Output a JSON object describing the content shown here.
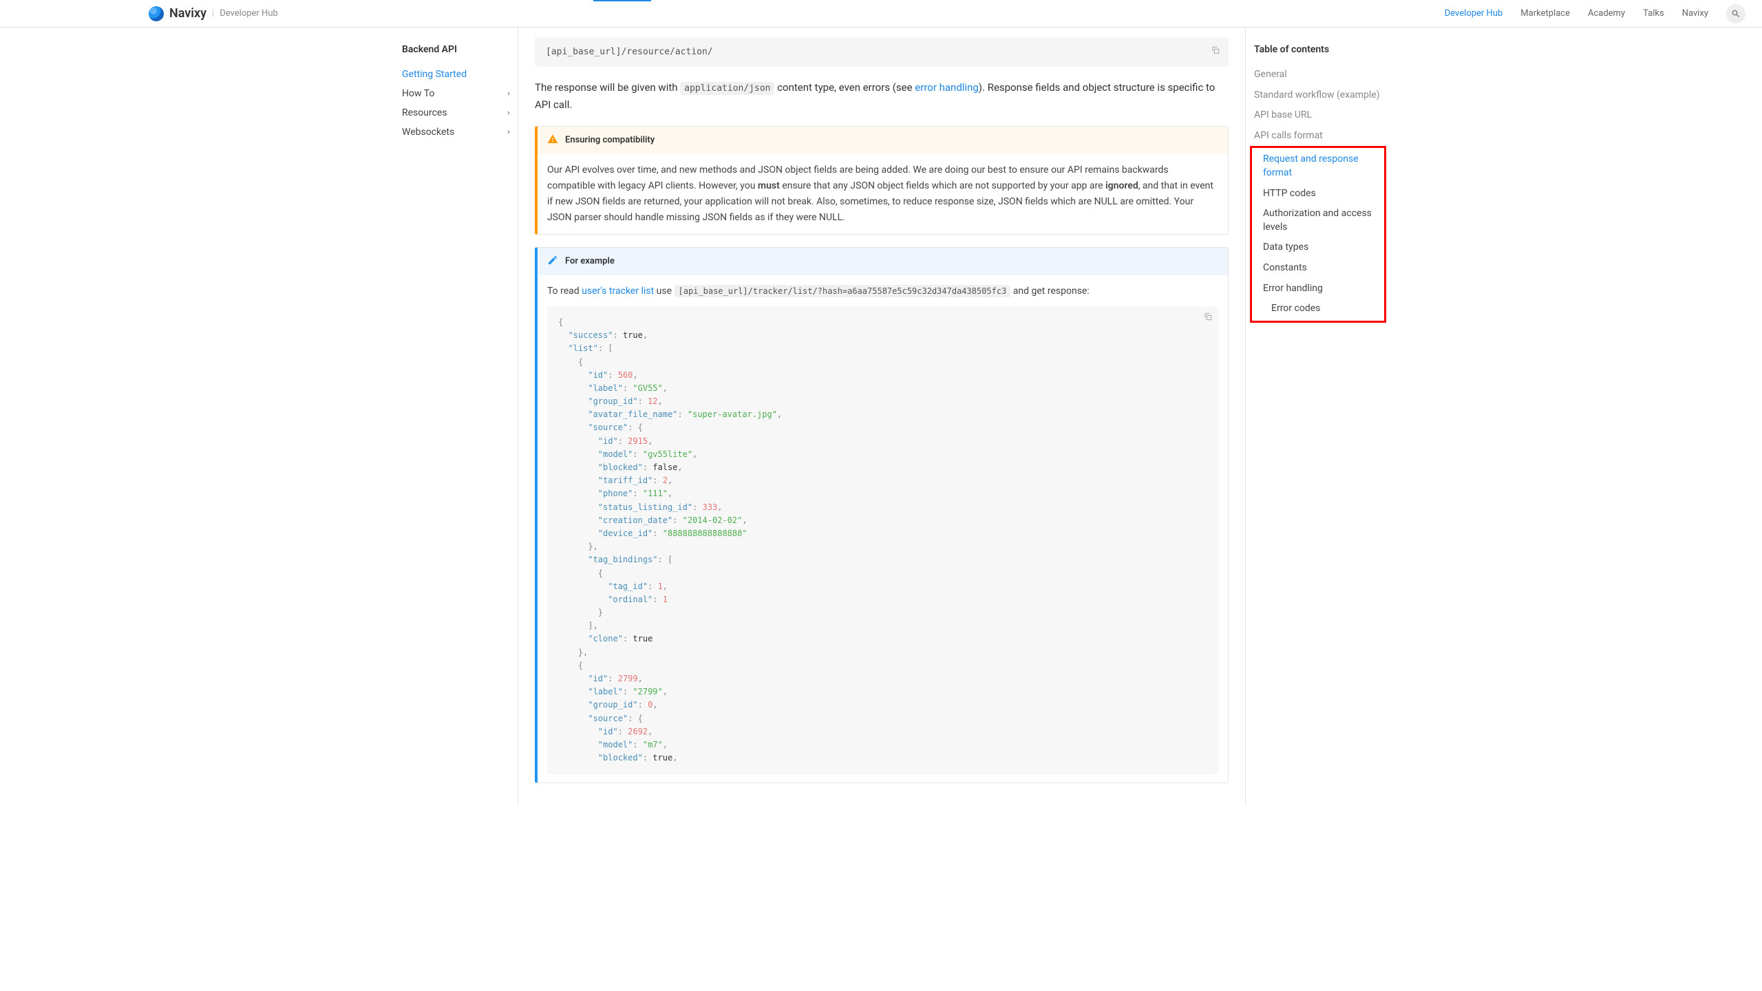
{
  "header": {
    "brand": "Navixy",
    "sub": "Developer Hub",
    "nav": [
      "Developer Hub",
      "Marketplace",
      "Academy",
      "Talks",
      "Navixy"
    ],
    "active_nav_index": 0
  },
  "sidebar": {
    "title": "Backend API",
    "items": [
      {
        "label": "Getting Started",
        "active": true,
        "expandable": false
      },
      {
        "label": "How To",
        "active": false,
        "expandable": true
      },
      {
        "label": "Resources",
        "active": false,
        "expandable": true
      },
      {
        "label": "Websockets",
        "active": false,
        "expandable": true
      }
    ]
  },
  "main": {
    "url_template": "[api_base_url]/resource/action/",
    "para1_pre": "The response will be given with ",
    "para1_code": "application/json",
    "para1_mid": " content type, even errors (see ",
    "para1_link": "error handling",
    "para1_post": "). Response fields and object structure is specific to API call.",
    "warn_title": "Ensuring compatibility",
    "warn_body_1": "Our API evolves over time, and new methods and JSON object fields are being added. We are doing our best to ensure our API remains backwards compatible with legacy API clients. However, you ",
    "warn_body_must": "must",
    "warn_body_2": " ensure that any JSON object fields which are not supported by your app are ",
    "warn_body_ignored": "ignored",
    "warn_body_3": ", and that in event if new JSON fields are returned, your application will not break. Also, sometimes, to reduce response size, JSON fields which are NULL are omitted. Your JSON parser should handle missing JSON fields as if they were NULL.",
    "ex_title": "For example",
    "ex_pre": "To read ",
    "ex_link": "user's tracker list",
    "ex_mid": " use ",
    "ex_code": "[api_base_url]/tracker/list/?hash=a6aa75587e5c59c32d347da438505fc3",
    "ex_post": " and get response:"
  },
  "toc": {
    "title": "Table of contents",
    "items": [
      {
        "label": "General",
        "cls": "toc-item"
      },
      {
        "label": "Standard workflow (example)",
        "cls": "toc-item"
      },
      {
        "label": "API base URL",
        "cls": "toc-item"
      },
      {
        "label": "API calls format",
        "cls": "toc-item"
      }
    ],
    "highlighted": [
      {
        "label": "Request and response format",
        "cls": "toc-item toc-sub active"
      },
      {
        "label": "HTTP codes",
        "cls": "toc-item toc-sub dark"
      },
      {
        "label": "Authorization and access levels",
        "cls": "toc-item toc-sub dark"
      },
      {
        "label": "Data types",
        "cls": "toc-item toc-sub dark"
      },
      {
        "label": "Constants",
        "cls": "toc-item toc-sub dark"
      },
      {
        "label": "Error handling",
        "cls": "toc-item toc-sub dark"
      },
      {
        "label": "Error codes",
        "cls": "toc-item toc-subsub dark"
      }
    ]
  },
  "json_response": {
    "success": true,
    "list": [
      {
        "id": 560,
        "label": "GV55",
        "group_id": 12,
        "avatar_file_name": "super-avatar.jpg",
        "source": {
          "id": 2915,
          "model": "gv55lite",
          "blocked": false,
          "tariff_id": 2,
          "phone": "111",
          "status_listing_id": 333,
          "creation_date": "2014-02-02",
          "device_id": "888888888888888"
        },
        "tag_bindings": [
          {
            "tag_id": 1,
            "ordinal": 1
          }
        ],
        "clone": true
      },
      {
        "id": 2799,
        "label": "2799",
        "group_id": 0,
        "source": {
          "id": 2692,
          "model": "m7",
          "blocked": true
        }
      }
    ]
  }
}
